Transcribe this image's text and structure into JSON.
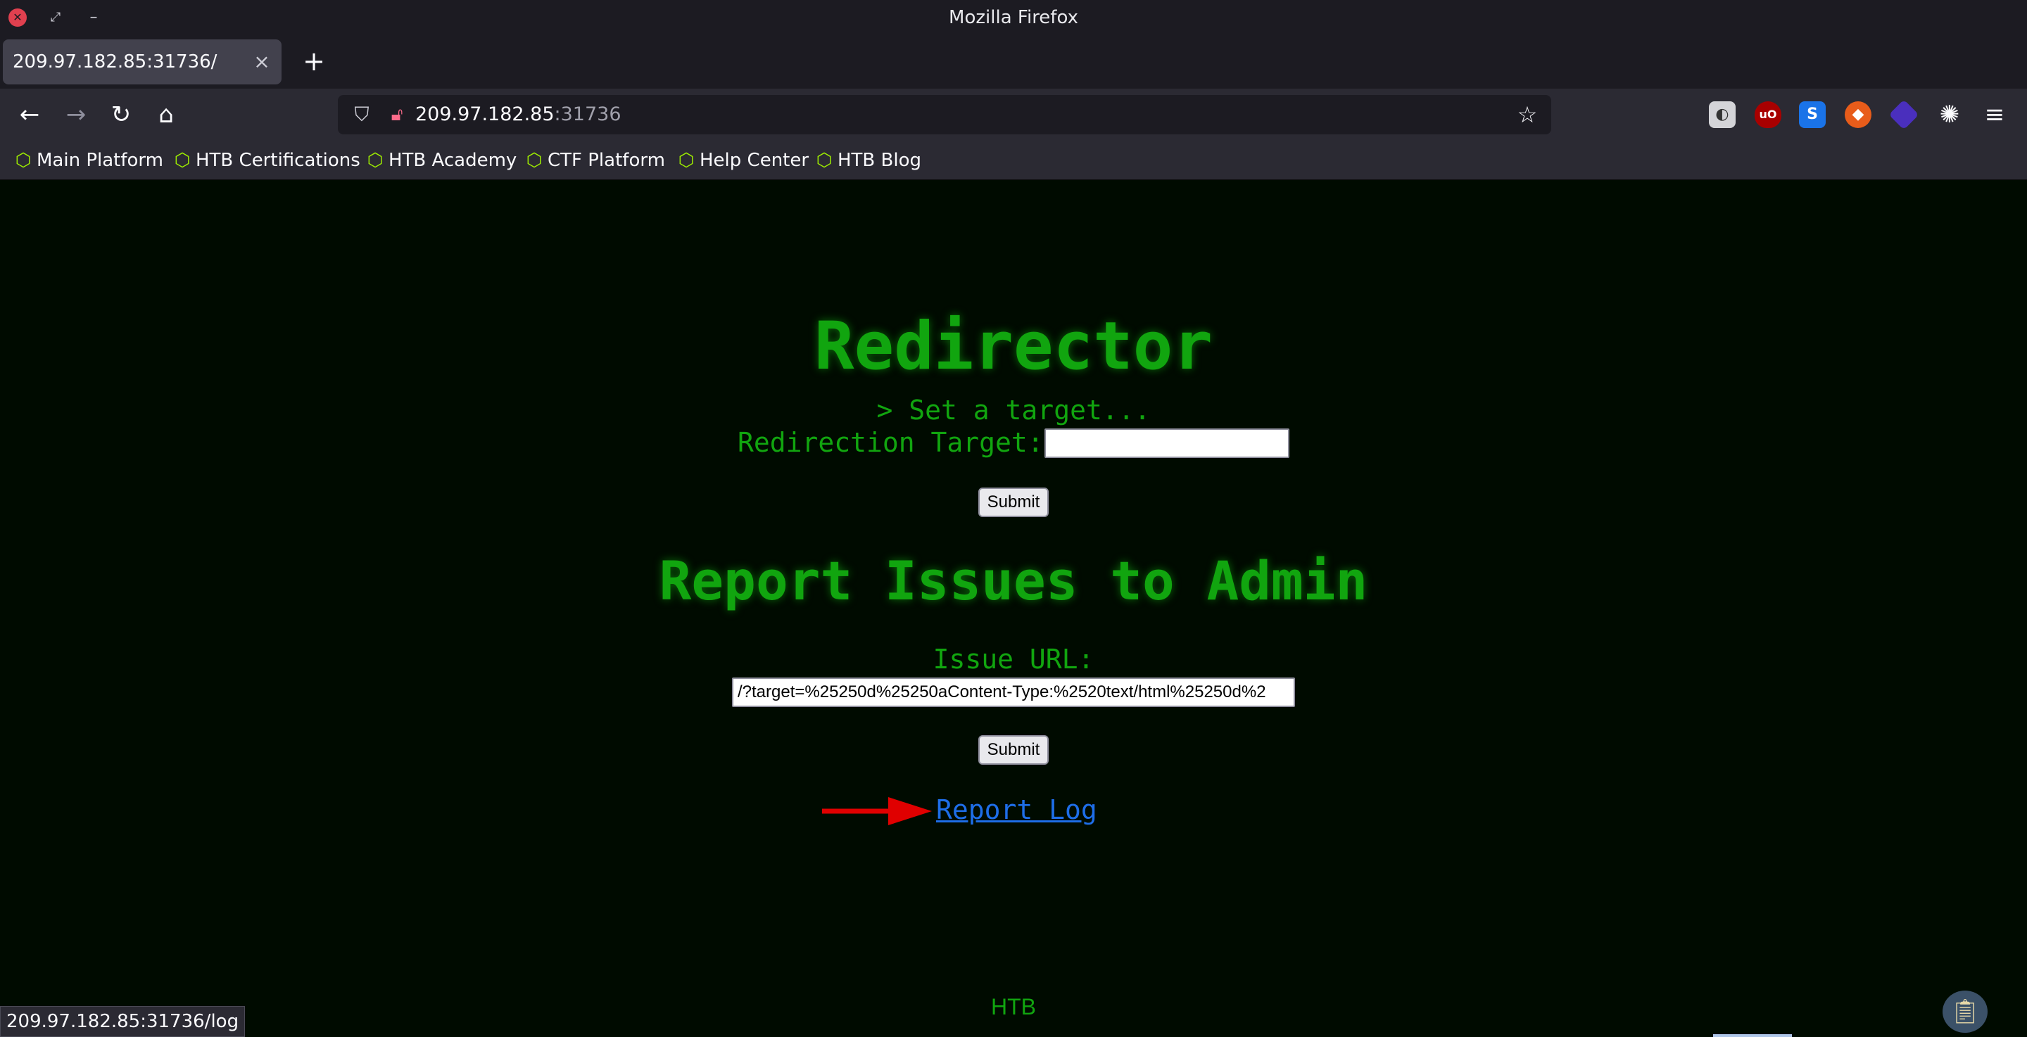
{
  "window": {
    "title": "Mozilla Firefox"
  },
  "tabs": [
    {
      "label": "209.97.182.85:31736/",
      "close": "×"
    }
  ],
  "new_tab": "+",
  "nav": {
    "back": "←",
    "forward": "→",
    "reload": "↻",
    "home": "⌂"
  },
  "url": {
    "host": "209.97.182.85",
    "port": ":31736"
  },
  "bookmarks": [
    {
      "label": "Main Platform",
      "icon": "hexagon-icon"
    },
    {
      "label": "HTB Certifications",
      "icon": "hexagon-icon"
    },
    {
      "label": "HTB Academy",
      "icon": "hexagon-icon"
    },
    {
      "label": "CTF Platform",
      "icon": "hexagon-icon"
    },
    {
      "label": "Help Center",
      "icon": "hexagon-icon"
    },
    {
      "label": "HTB Blog",
      "icon": "hexagon-icon"
    }
  ],
  "page": {
    "title": "Redirector",
    "subtitle": "> Set a target...",
    "target_label": "Redirection Target:",
    "target_value": "",
    "submit_label": "Submit",
    "report_title": "Report Issues to Admin",
    "issue_label": "Issue URL:",
    "issue_value": "/?target=%25250d%25250aContent-Type:%2520text/html%25250d%2",
    "report_log": "Report Log",
    "footer": "HTB"
  },
  "status": {
    "link_preview": "209.97.182.85:31736/log"
  },
  "colors": {
    "accent": "#11a50f",
    "link": "#1e6ee8",
    "page_bg": "#000b00",
    "arrow": "#e00000"
  }
}
